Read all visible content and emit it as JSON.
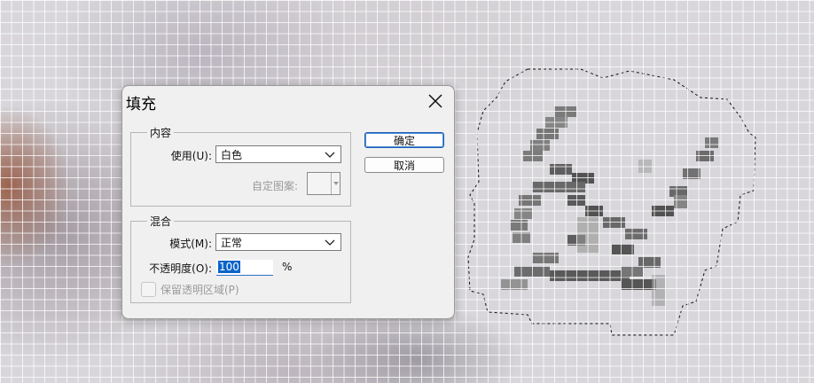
{
  "dialog": {
    "title": "填充",
    "close_icon": "close-icon",
    "contents_group": {
      "legend": "内容",
      "use_label": "使用(U):",
      "use_value": "白色",
      "custom_pattern_label": "自定图案:"
    },
    "blending_group": {
      "legend": "混合",
      "mode_label": "模式(M):",
      "mode_value": "正常",
      "opacity_label": "不透明度(O):",
      "opacity_value": "100",
      "opacity_unit": "%",
      "preserve_transparency_label": "保留透明区域(P)",
      "preserve_transparency_checked": false
    },
    "buttons": {
      "ok": "确定",
      "cancel": "取消"
    }
  },
  "colors": {
    "accent": "#0a64c8",
    "dialog_bg": "#f0f0f0",
    "canvas_bg": "#d8d6da"
  }
}
